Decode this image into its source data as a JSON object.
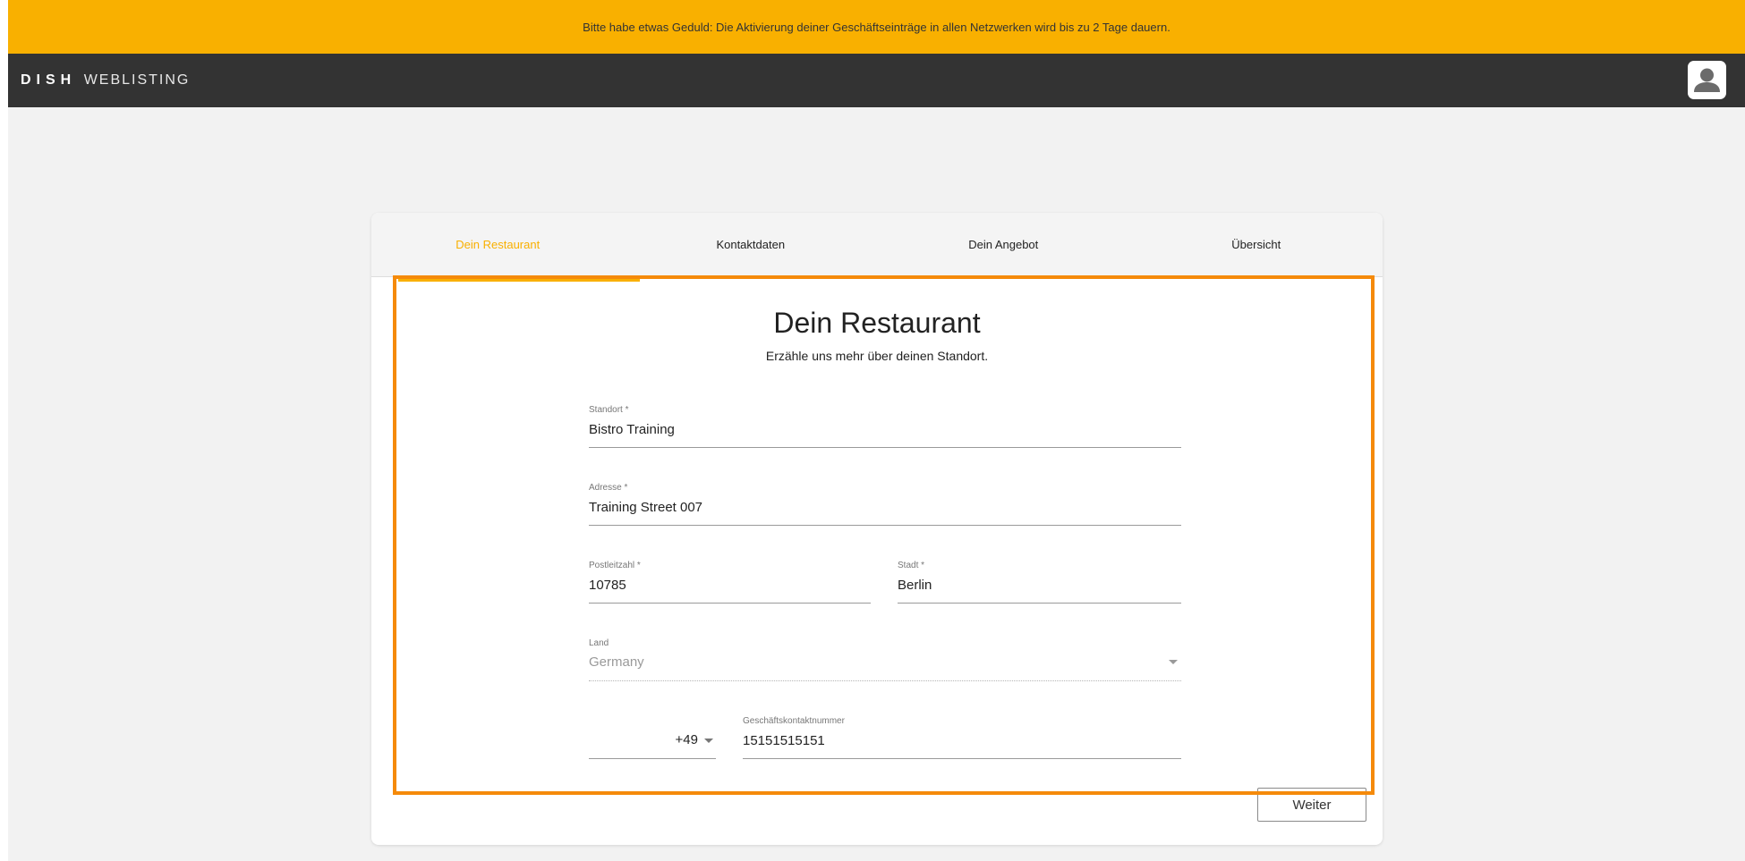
{
  "banner": {
    "text": "Bitte habe etwas Geduld: Die Aktivierung deiner Geschäftseinträge in allen Netzwerken wird bis zu 2 Tage dauern."
  },
  "header": {
    "logo_brand": "DISH",
    "logo_product": "WEBLISTING",
    "avatar_icon": "user-icon"
  },
  "tabs": [
    {
      "label": "Dein Restaurant",
      "active": true
    },
    {
      "label": "Kontaktdaten",
      "active": false
    },
    {
      "label": "Dein Angebot",
      "active": false
    },
    {
      "label": "Übersicht",
      "active": false
    }
  ],
  "form": {
    "title": "Dein Restaurant",
    "subtitle": "Erzähle uns mehr über deinen Standort.",
    "fields": {
      "location": {
        "label": "Standort *",
        "value": "Bistro Training"
      },
      "address": {
        "label": "Adresse *",
        "value": "Training Street 007"
      },
      "zip": {
        "label": "Postleitzahl *",
        "value": "10785"
      },
      "city": {
        "label": "Stadt *",
        "value": "Berlin"
      },
      "country": {
        "label": "Land",
        "value": "Germany"
      },
      "phone_code": {
        "value": "+49"
      },
      "phone": {
        "label": "Geschäftskontaktnummer",
        "value": "15151515151"
      }
    },
    "next_label": "Weiter"
  },
  "colors": {
    "accent": "#f9b000",
    "topbar": "#333333",
    "highlight": "#f58a0a",
    "background": "#f2f2f2"
  }
}
